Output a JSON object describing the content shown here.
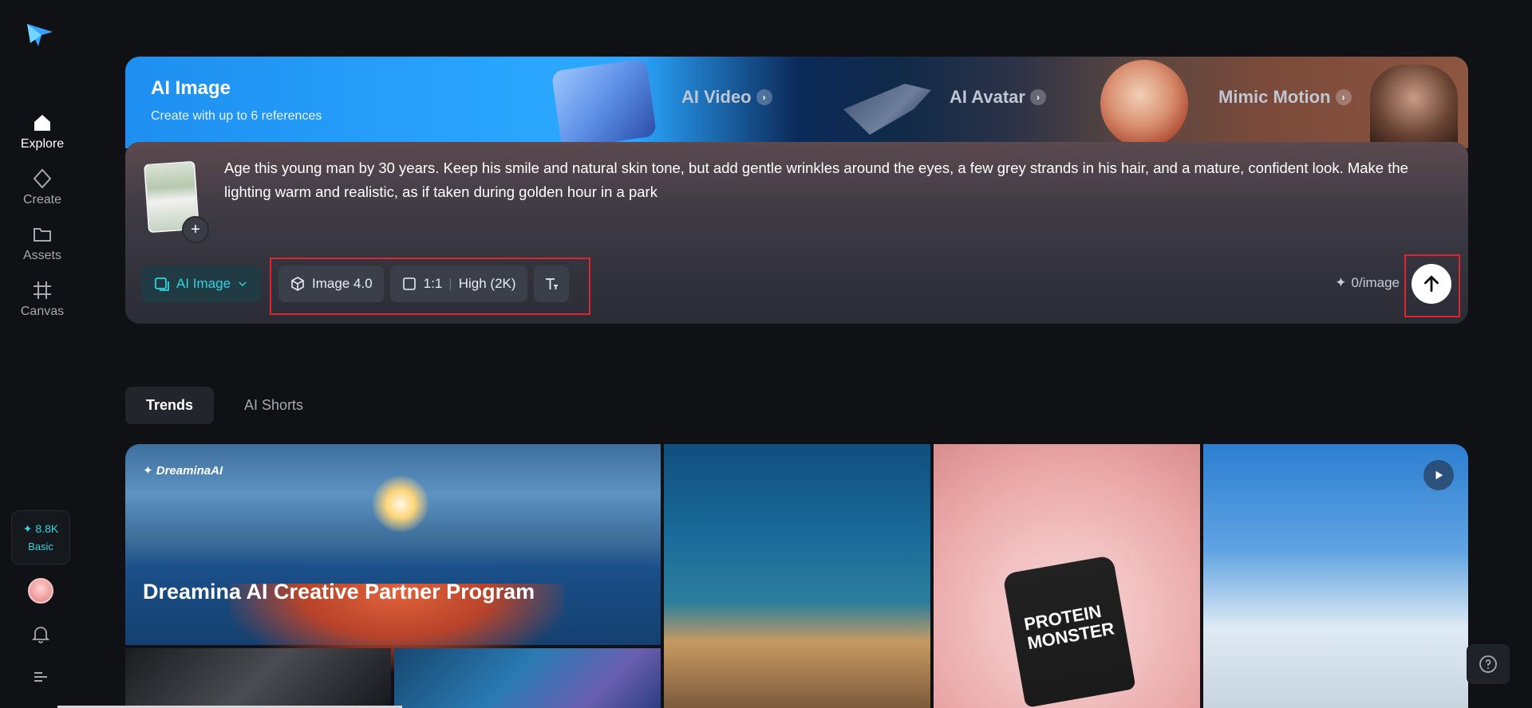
{
  "sidebar": {
    "items": [
      {
        "label": "Explore",
        "icon": "home-icon",
        "active": true
      },
      {
        "label": "Create",
        "icon": "diamond-icon"
      },
      {
        "label": "Assets",
        "icon": "folder-icon"
      },
      {
        "label": "Canvas",
        "icon": "canvas-icon"
      }
    ],
    "credits": {
      "amount": "✦ 8.8K",
      "plan": "Basic"
    }
  },
  "hero": {
    "title": "AI Image",
    "subtitle": "Create with up to 6 references",
    "promos": [
      {
        "label": "AI Video"
      },
      {
        "label": "AI Avatar"
      },
      {
        "label": "Mimic Motion"
      }
    ],
    "prompt": "Age this young man by 30 years. Keep his smile and natural skin tone, but add gentle wrinkles around the eyes, a few grey strands in his hair, and a mature, confident look. Make the lighting warm and realistic, as if taken during golden hour in a park",
    "toolbar": {
      "mode": "AI Image",
      "model": "Image 4.0",
      "ratio": "1:1",
      "quality": "High (2K)",
      "cost": "0/image"
    }
  },
  "tabs": [
    {
      "label": "Trends",
      "active": true
    },
    {
      "label": "AI Shorts"
    }
  ],
  "gallery": {
    "banner_brand": "DreaminaAI",
    "banner_headline": "Dreamina AI Creative Partner Program",
    "protein_label": "PROTEIN MONSTER"
  },
  "colors": {
    "accent": "#2ed3e2",
    "highlight": "#e0232e"
  }
}
